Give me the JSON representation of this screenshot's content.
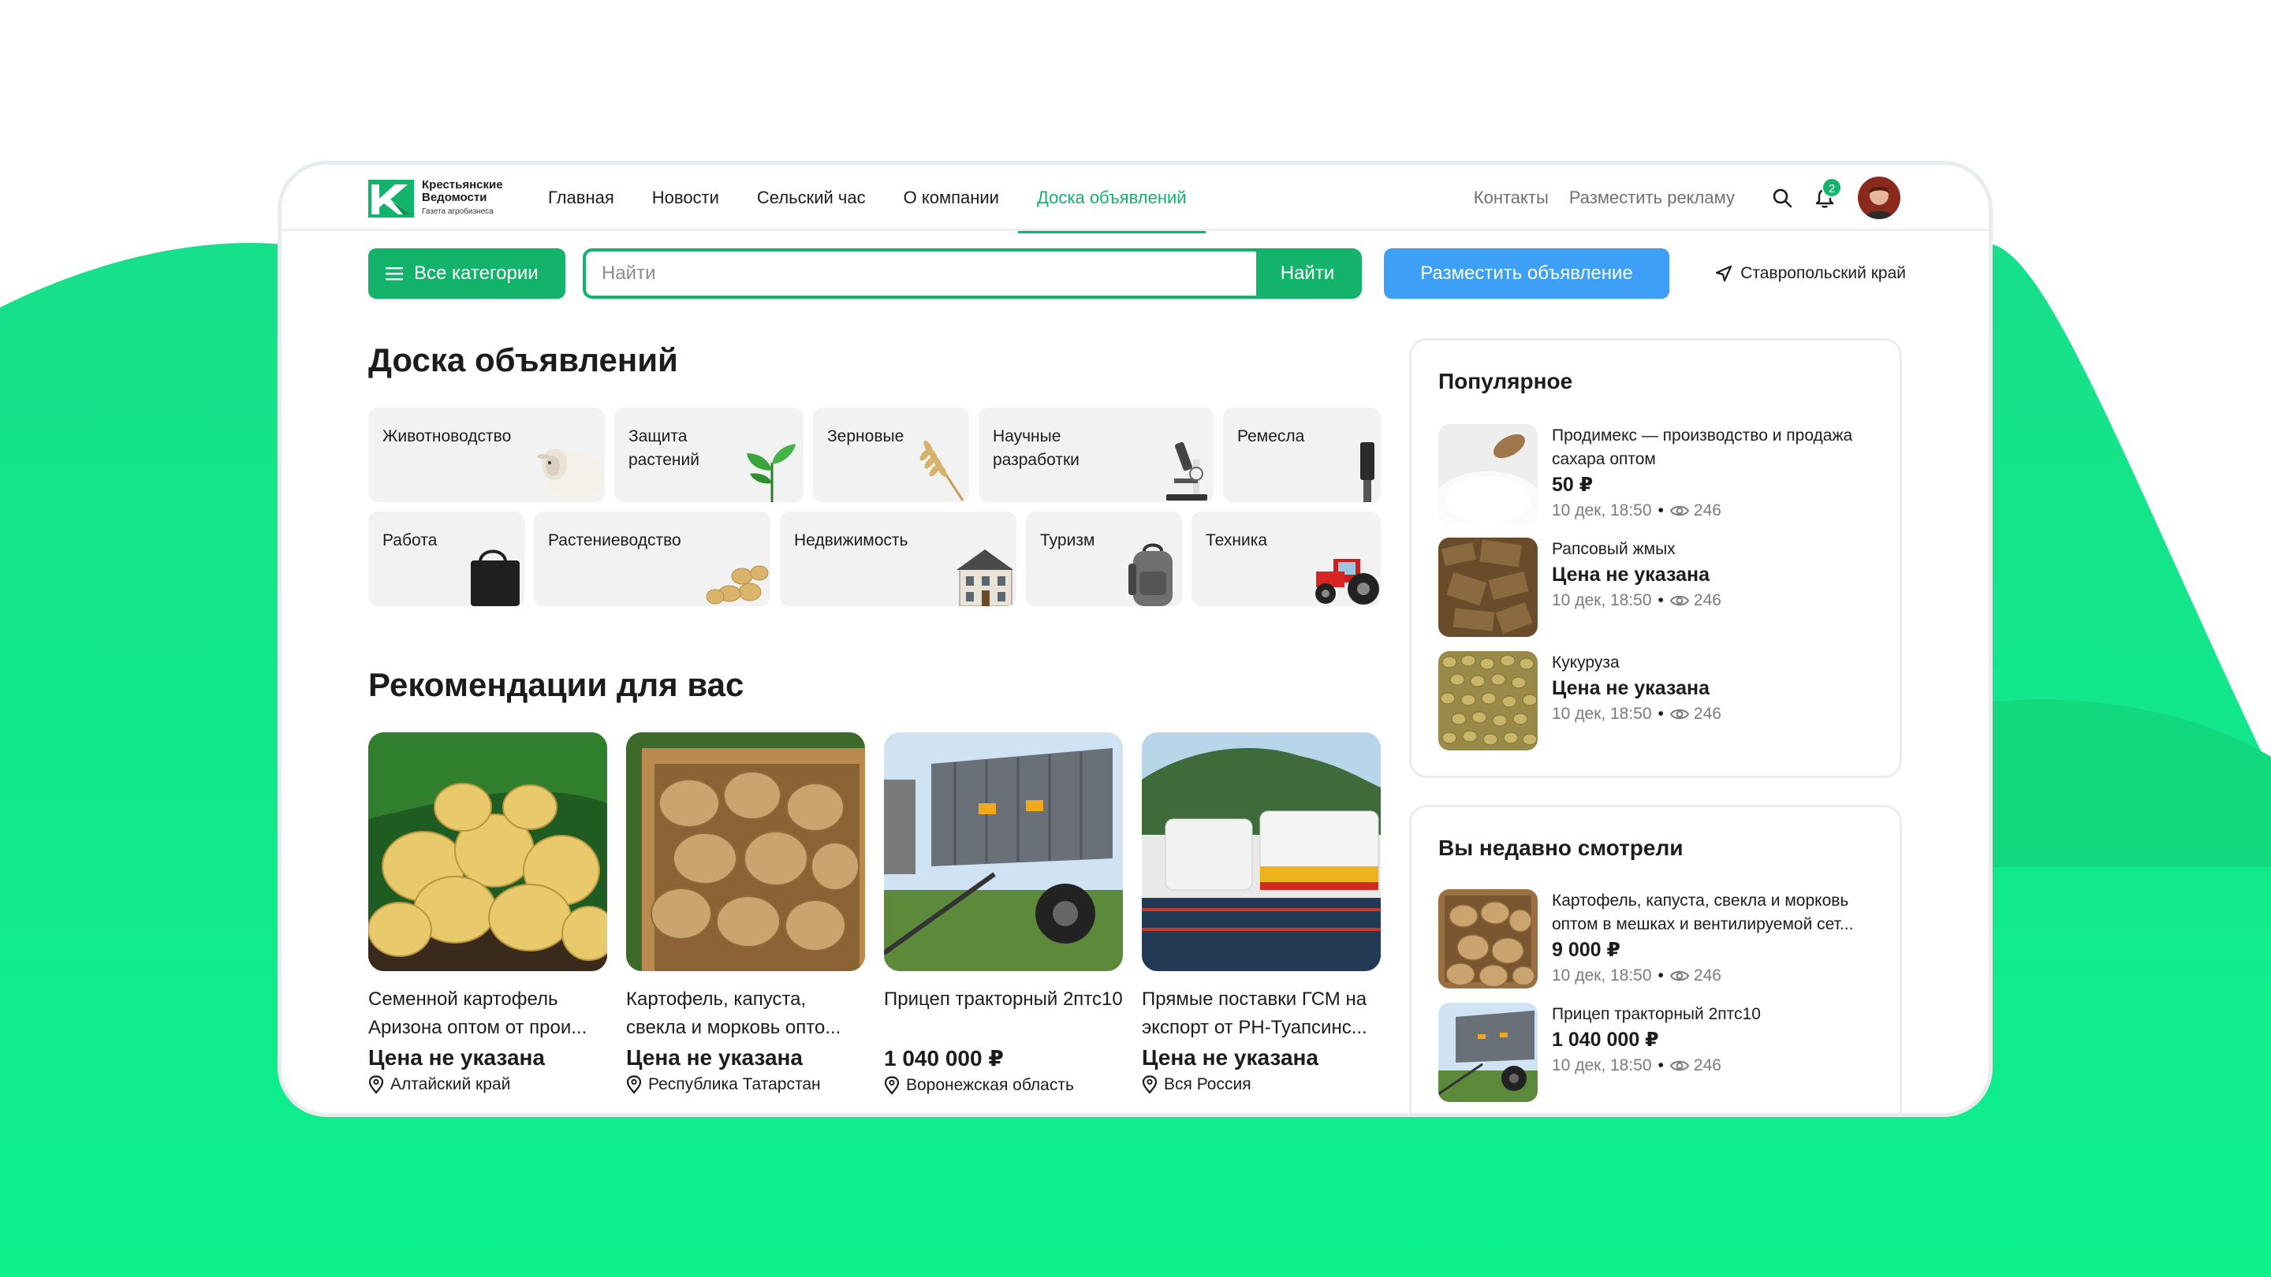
{
  "brand": {
    "name_line1": "Крестьянские",
    "name_line2": "Ведомости",
    "tagline": "Газета агробизнеса",
    "accent_color": "#14b36b",
    "blue_color": "#3d9ff5"
  },
  "nav": {
    "items": [
      {
        "label": "Главная"
      },
      {
        "label": "Новости"
      },
      {
        "label": "Сельский час"
      },
      {
        "label": "О компании"
      },
      {
        "label": "Доска объявлений",
        "active": true
      }
    ],
    "contacts": "Контакты",
    "advertise": "Разместить рекламу",
    "notifications_count": "2",
    "icons": [
      "search-icon",
      "bell-icon",
      "avatar"
    ]
  },
  "search": {
    "all_categories": "Все категории",
    "placeholder": "Найти",
    "value": "",
    "button": "Найти",
    "post_ad": "Разместить объявление",
    "region": "Ставропольский край"
  },
  "board": {
    "title": "Доска объявлений",
    "categories_row1": [
      {
        "label": "Животноводство",
        "icon": "sheep"
      },
      {
        "label": "Защита растений",
        "icon": "plant"
      },
      {
        "label": "Зерновые",
        "icon": "wheat"
      },
      {
        "label": "Научные разработки",
        "icon": "microscope"
      },
      {
        "label": "Ремесла",
        "icon": "chisel"
      }
    ],
    "categories_row2": [
      {
        "label": "Работа",
        "icon": "bag"
      },
      {
        "label": "Растениеводство",
        "icon": "potatoes"
      },
      {
        "label": "Недвижимость",
        "icon": "house"
      },
      {
        "label": "Туризм",
        "icon": "backpack"
      },
      {
        "label": "Техника",
        "icon": "tractor"
      }
    ]
  },
  "recommendations": {
    "title": "Рекомендации для вас",
    "items": [
      {
        "title": "Семенной картофель Аризона оптом от прои...",
        "price": "Цена не указана",
        "location": "Алтайский край"
      },
      {
        "title": "Картофель, капуста, свекла и морковь опто...",
        "price": "Цена не указана",
        "location": "Республика Татарстан"
      },
      {
        "title": "Прицеп тракторный 2птс10",
        "price": "1 040 000 ₽",
        "location": "Воронежская область"
      },
      {
        "title": "Прямые поставки ГСМ на экспорт от РН-Туапсинс...",
        "price": "Цена не указана",
        "location": "Вся Россия"
      }
    ]
  },
  "popular": {
    "title": "Популярное",
    "items": [
      {
        "name": "Продимекс — производство и продажа сахара оптом",
        "price": "50 ₽",
        "date": "10 дек, 18:50",
        "views": "246"
      },
      {
        "name": "Рапсовый жмых",
        "price": "Цена не указана",
        "date": "10 дек, 18:50",
        "views": "246"
      },
      {
        "name": "Кукуруза",
        "price": "Цена не указана",
        "date": "10 дек, 18:50",
        "views": "246"
      }
    ]
  },
  "recent": {
    "title": "Вы недавно смотрели",
    "items": [
      {
        "name": "Картофель, капуста, свекла и морковь оптом в мешках и вентилируемой сет...",
        "price": "9 000 ₽",
        "date": "10 дек, 18:50",
        "views": "246"
      },
      {
        "name": "Прицеп тракторный 2птс10",
        "price": "1 040 000 ₽",
        "date": "10 дек, 18:50",
        "views": "246"
      }
    ]
  }
}
